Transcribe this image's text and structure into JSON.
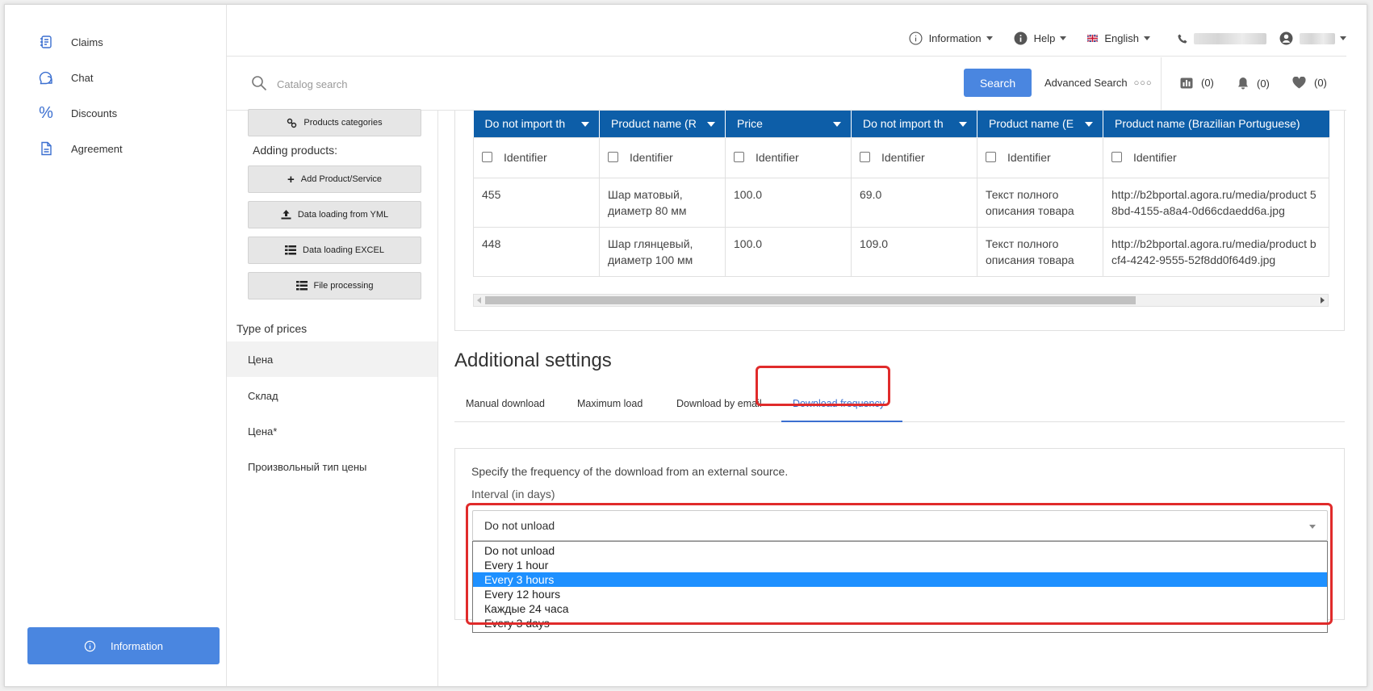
{
  "sidebar": {
    "items": [
      {
        "label": "Claims",
        "icon": "claims-icon"
      },
      {
        "label": "Chat",
        "icon": "chat-icon"
      },
      {
        "label": "Discounts",
        "icon": "percent-icon"
      },
      {
        "label": "Agreement",
        "icon": "document-icon"
      }
    ],
    "info_button": "Information"
  },
  "header": {
    "information": "Information",
    "help": "Help",
    "language": "English"
  },
  "search": {
    "placeholder": "Catalog search",
    "button": "Search",
    "advanced": "Advanced Search",
    "compare_count": "(0)",
    "notifications_count": "(0)",
    "favorites_count": "(0)"
  },
  "settings_panel": {
    "categories_button": "Products categories",
    "adding_heading": "Adding products:",
    "add_product": "Add Product/Service",
    "yml_loading": "Data loading from YML",
    "excel_loading": "Data loading EXCEL",
    "file_processing": "File processing",
    "price_types_heading": "Type of prices",
    "price_types": [
      "Цена",
      "Склад",
      "Цена*",
      "Произвольный тип цены"
    ]
  },
  "table": {
    "columns": [
      "Do not import th",
      "Product name (R",
      "Price",
      "Do not import th",
      "Product name (E",
      "Product name (Brazilian Portuguese)"
    ],
    "identifier_label": "Identifier",
    "rows": [
      [
        "455",
        "Шар матовый, диаметр 80 мм",
        "100.0",
        "69.0",
        "Текст полного описания товара",
        "http://b2bportal.agora.ru/media/product 58bd-4155-a8a4-0d66cdaedd6a.jpg"
      ],
      [
        "448",
        "Шар глянцевый, диаметр 100 мм",
        "100.0",
        "109.0",
        "Текст полного описания товара",
        "http://b2bportal.agora.ru/media/product bcf4-4242-9555-52f8dd0f64d9.jpg"
      ]
    ]
  },
  "additional": {
    "title": "Additional settings",
    "tabs": [
      "Manual download",
      "Maximum load",
      "Download by email",
      "Download frequency"
    ],
    "active_tab": "Download frequency",
    "description": "Specify the frequency of the download from an external source.",
    "interval_label": "Interval (in days)",
    "selected_value": "Do not unload",
    "options": [
      "Do not unload",
      "Every 1 hour",
      "Every 3 hours",
      "Every 12 hours",
      "Каждые 24 часа",
      "Every 3 days"
    ],
    "highlighted_option": "Every 3 hours"
  },
  "colors": {
    "accent": "#4a86e0",
    "table_header": "#0d5ea8",
    "highlight": "#e02b2b",
    "option_selected": "#1e90ff"
  }
}
